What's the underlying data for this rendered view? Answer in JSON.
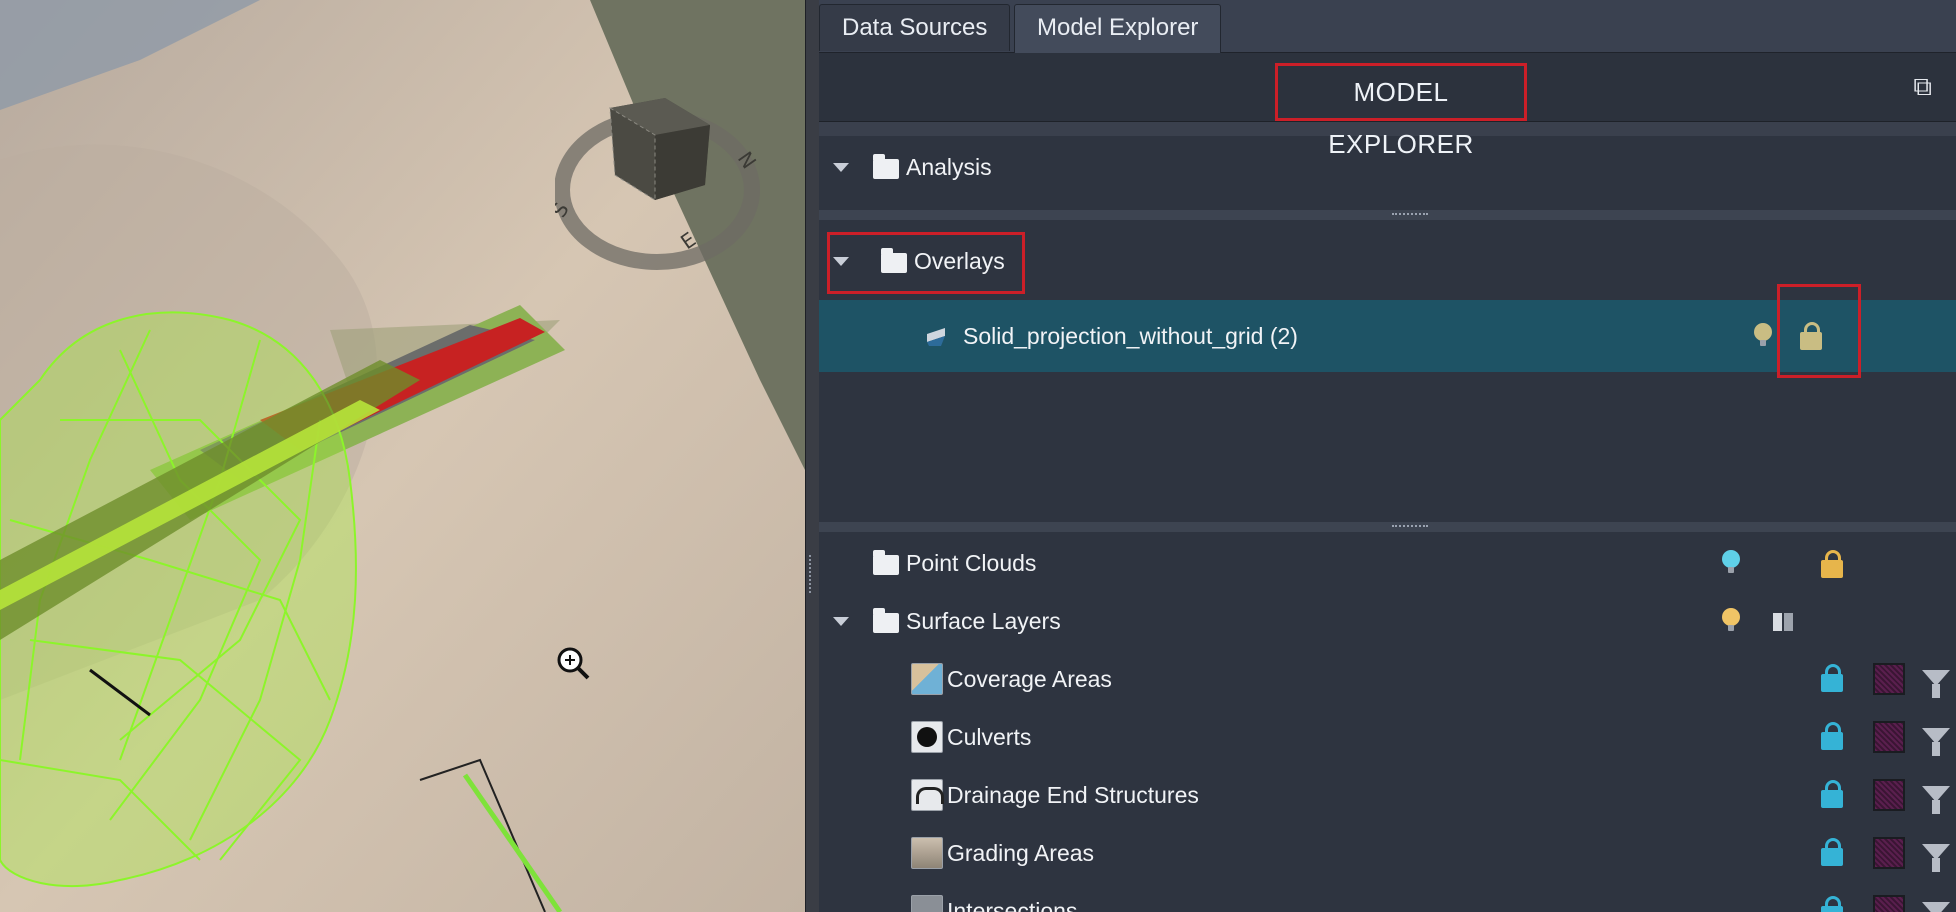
{
  "tabs": [
    {
      "label": "Data Sources",
      "active": false
    },
    {
      "label": "Model Explorer",
      "active": true
    }
  ],
  "header": {
    "title": "MODEL EXPLORER"
  },
  "tree": {
    "analysis": {
      "label": "Analysis"
    },
    "overlays": {
      "label": "Overlays",
      "children": [
        {
          "label": "Solid_projection_without_grid (2)",
          "selected": true
        }
      ]
    },
    "point_clouds": {
      "label": "Point Clouds"
    },
    "surface_layers": {
      "label": "Surface Layers",
      "children": [
        {
          "label": "Coverage Areas",
          "icon": "coverage-areas-icon"
        },
        {
          "label": "Culverts",
          "icon": "culverts-icon"
        },
        {
          "label": "Drainage End Structures",
          "icon": "drainage-end-structures-icon"
        },
        {
          "label": "Grading Areas",
          "icon": "grading-areas-icon"
        },
        {
          "label": "Intersections",
          "icon": "intersections-icon"
        }
      ]
    }
  },
  "viewcube": {
    "compass": [
      "N",
      "E",
      "S"
    ]
  },
  "colors": {
    "highlight_red": "#cc1f28",
    "selection_row": "#1e5365",
    "lock_cyan": "#35b3d6",
    "lock_gold": "#e7b54b",
    "wireframe_green": "#8cf52a"
  }
}
